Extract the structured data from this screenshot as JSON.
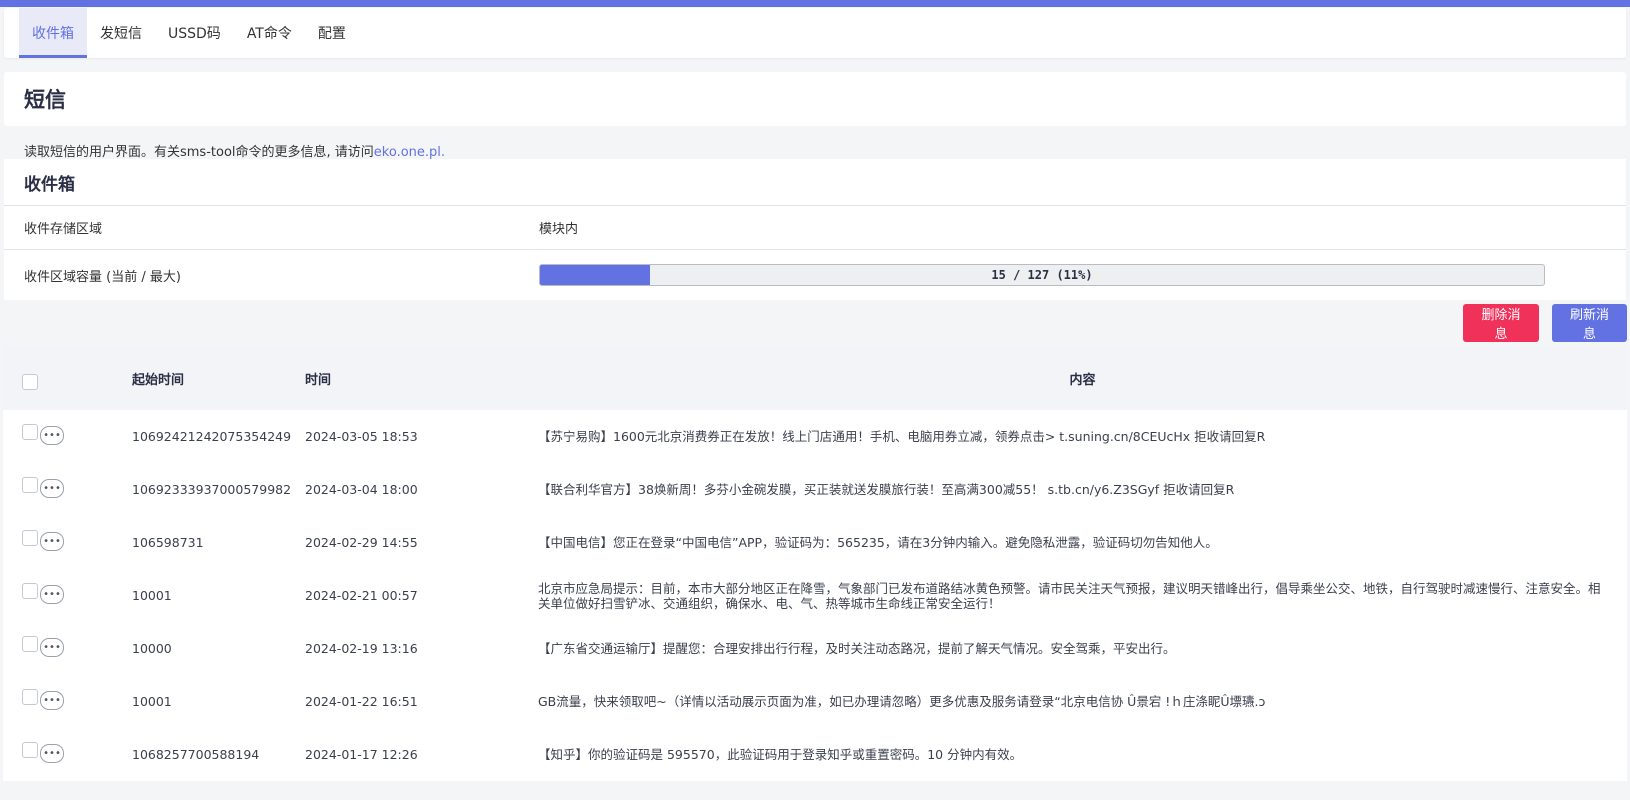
{
  "tabs": [
    "收件箱",
    "发短信",
    "USSD码",
    "AT命令",
    "配置"
  ],
  "page": {
    "title": "短信",
    "description": "读取短信的用户界面。有关sms-tool命令的更多信息, 请访问",
    "link_text": "eko.one.pl."
  },
  "inbox": {
    "title": "收件箱",
    "storage_label": "收件存储区域",
    "storage_value": "模块内",
    "capacity_label": "收件区域容量 (当前 / 最大)",
    "capacity_text": "15 / 127 (11%)",
    "capacity_fraction": 0.11
  },
  "actions": {
    "delete": "删除消息",
    "refresh": "刷新消息"
  },
  "table": {
    "headers": {
      "from": "起始时间",
      "time": "时间",
      "content": "内容"
    },
    "rows": [
      {
        "from": "10692421242075354249",
        "time": "2024-03-05 18:53",
        "content": "【苏宁易购】1600元北京消费券正在发放！线上门店通用！手机、电脑用券立减，领券点击> t.suning.cn/8CEUcHx 拒收请回复R"
      },
      {
        "from": "1069233393700057998​2",
        "time": "2024-03-04 18:00",
        "content": "【联合利华官方】38焕新周！多芬小金碗发膜，买正装就送发膜旅行装！至高满300减55！ s.tb.cn/y6.Z3SGyf 拒收请回复R"
      },
      {
        "from": "106598731",
        "time": "2024-02-29 14:55",
        "content": "【中国电信】您正在登录“中国电信”APP，验证码为：565235，请在3分钟内输入。避免隐私泄露，验证码切勿告知他人。"
      },
      {
        "from": "10001",
        "time": "2024-02-21 00:57",
        "content": "北京市应急局提示：目前，本市大部分地区正在降雪，气象部门已发布道路结冰黄色预警。请市民关注天气预报，建议明天错峰出行，倡导乘坐公交、地铁，自行驾驶时减速慢行、注意安全。相关单位做好扫雪铲冰、交通组织，确保水、电、气、热等城市生命线正常安全运行！"
      },
      {
        "from": "10000",
        "time": "2024-02-19 13:16",
        "content": "【广东省交通运输厅】提醒您：合理安排出行行程，及时关注动态路况，提前了解天气情况。安全驾乘，平安出行。"
      },
      {
        "from": "10001",
        "time": "2024-01-22 16:51",
        "content": "GB流量，快来领取吧~（详情以活动展示页面为准，如已办理请忽略）更多优惠及服务请登录“北京电信协   Û景宕   !ｈ庄涤眤Û墂瓙.ɔ"
      },
      {
        "from": "1068257700588194",
        "time": "2024-01-17 12:26",
        "content": "【知乎】你的验证码是 595570，此验证码用于登录知乎或重置密码。10 分钟内有效。"
      }
    ]
  }
}
